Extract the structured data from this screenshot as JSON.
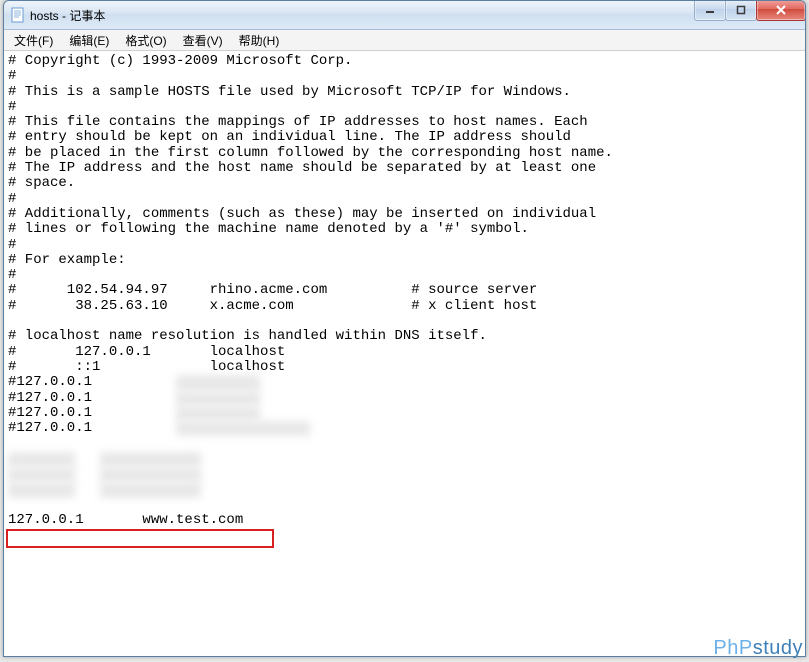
{
  "window": {
    "title": "hosts - 记事本"
  },
  "menu": {
    "file": "文件(F)",
    "edit": "编辑(E)",
    "format": "格式(O)",
    "view": "查看(V)",
    "help": "帮助(H)"
  },
  "hosts_text": {
    "l01": "# Copyright (c) 1993-2009 Microsoft Corp.",
    "l02": "#",
    "l03": "# This is a sample HOSTS file used by Microsoft TCP/IP for Windows.",
    "l04": "#",
    "l05": "# This file contains the mappings of IP addresses to host names. Each",
    "l06": "# entry should be kept on an individual line. The IP address should",
    "l07": "# be placed in the first column followed by the corresponding host name.",
    "l08": "# The IP address and the host name should be separated by at least one",
    "l09": "# space.",
    "l10": "#",
    "l11": "# Additionally, comments (such as these) may be inserted on individual",
    "l12": "# lines or following the machine name denoted by a '#' symbol.",
    "l13": "#",
    "l14": "# For example:",
    "l15": "#",
    "l16": "#      102.54.94.97     rhino.acme.com          # source server",
    "l17": "#       38.25.63.10     x.acme.com              # x client host",
    "l18": "",
    "l19": "# localhost name resolution is handled within DNS itself.",
    "l20": "#       127.0.0.1       localhost",
    "l21": "#       ::1             localhost",
    "l22a": "#127.0.0.1          ",
    "l23a": "#127.0.0.1          ",
    "l24a": "#127.0.0.1          ",
    "l25a": "#127.0.0.1          ",
    "blank": "",
    "hl": "127.0.0.1       www.test.com"
  },
  "redacted": {
    "r22": "xxxxxxxxxx",
    "r23": "xxxxxxxxxx",
    "r24": "xxxxxxxxxx",
    "r25": "xxxxxxxxxxxxxxxx",
    "row1a": "xxxxxxxx",
    "row1b": "xxxxxxxxxxxx",
    "row2a": "xxxxxxxx",
    "row2b": "xxxxxxxxxxxx",
    "row3a": "xxxxxxxx",
    "row3b": "xxxxxxxxxxxx"
  },
  "watermark": {
    "part1": "PhP",
    "part2": "study"
  }
}
